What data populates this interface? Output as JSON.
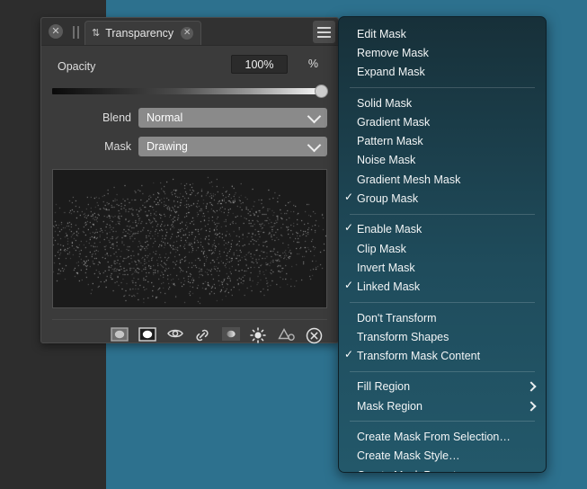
{
  "canvas": {
    "background_dark": "#2d2d2d",
    "background_teal": "#2d718e"
  },
  "panel": {
    "titlebar": {
      "close_button": "✕",
      "grip": "grip-handle",
      "tab": {
        "chevron_icon": "⇅",
        "label": "Transparency",
        "close_icon": "✕"
      },
      "menu_button": "hamburger-menu"
    },
    "opacity": {
      "label": "Opacity",
      "value": "100%",
      "unit": "%",
      "slider_percent": 100
    },
    "blend": {
      "label": "Blend",
      "value": "Normal"
    },
    "mask": {
      "label": "Mask",
      "value": "Drawing"
    },
    "footer_icons": [
      {
        "name": "mask-thumbnail-icon",
        "title": "Mask Thumbnail"
      },
      {
        "name": "mask-preview-icon",
        "title": "Mask Preview"
      },
      {
        "name": "eye-visibility-icon",
        "title": "Show Mask"
      },
      {
        "name": "link-chain-icon",
        "title": "Link Mask"
      },
      {
        "name": "mask-gradient-icon",
        "title": "Gradient Mask"
      },
      {
        "name": "brightness-icon",
        "title": "Brightness"
      },
      {
        "name": "shapes-icon",
        "title": "Shapes"
      },
      {
        "name": "delete-circle-icon",
        "title": "Remove Mask"
      }
    ]
  },
  "context_menu": {
    "groups": [
      {
        "items": [
          {
            "label": "Edit Mask",
            "checked": false,
            "submenu": false
          },
          {
            "label": "Remove Mask",
            "checked": false,
            "submenu": false
          },
          {
            "label": "Expand Mask",
            "checked": false,
            "submenu": false
          }
        ]
      },
      {
        "items": [
          {
            "label": "Solid Mask",
            "checked": false,
            "submenu": false
          },
          {
            "label": "Gradient Mask",
            "checked": false,
            "submenu": false
          },
          {
            "label": "Pattern Mask",
            "checked": false,
            "submenu": false
          },
          {
            "label": "Noise Mask",
            "checked": false,
            "submenu": false
          },
          {
            "label": "Gradient Mesh Mask",
            "checked": false,
            "submenu": false
          },
          {
            "label": "Group Mask",
            "checked": true,
            "submenu": false
          }
        ]
      },
      {
        "items": [
          {
            "label": "Enable Mask",
            "checked": true,
            "submenu": false
          },
          {
            "label": "Clip Mask",
            "checked": false,
            "submenu": false
          },
          {
            "label": "Invert Mask",
            "checked": false,
            "submenu": false
          },
          {
            "label": "Linked Mask",
            "checked": true,
            "submenu": false
          }
        ]
      },
      {
        "items": [
          {
            "label": "Don't Transform",
            "checked": false,
            "submenu": false
          },
          {
            "label": "Transform Shapes",
            "checked": false,
            "submenu": false
          },
          {
            "label": "Transform Mask Content",
            "checked": true,
            "submenu": false
          }
        ]
      },
      {
        "items": [
          {
            "label": "Fill Region",
            "checked": false,
            "submenu": true
          },
          {
            "label": "Mask Region",
            "checked": false,
            "submenu": true
          }
        ]
      },
      {
        "items": [
          {
            "label": "Create Mask From Selection…",
            "checked": false,
            "submenu": false
          },
          {
            "label": "Create Mask Style…",
            "checked": false,
            "submenu": false
          },
          {
            "label": "Create Mask Preset…",
            "checked": false,
            "submenu": false
          }
        ]
      }
    ],
    "check_glyph": "✓",
    "background_color": "#1f4c5c"
  }
}
